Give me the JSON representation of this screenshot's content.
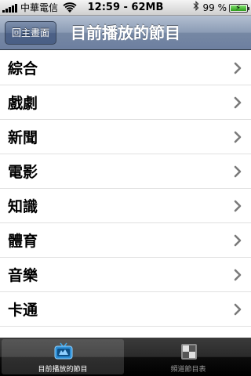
{
  "status_bar": {
    "carrier": "中華電信",
    "time": "12:59 - 62MB",
    "battery_percent": "99 %",
    "battery_level": 0.99
  },
  "nav": {
    "back_label": "回主畫面",
    "title": "目前播放的節目"
  },
  "list": {
    "items": [
      {
        "label": "綜合"
      },
      {
        "label": "戲劇"
      },
      {
        "label": "新聞"
      },
      {
        "label": "電影"
      },
      {
        "label": "知識"
      },
      {
        "label": "體育"
      },
      {
        "label": "音樂"
      },
      {
        "label": "卡通"
      },
      {
        "label": ""
      }
    ]
  },
  "tabbar": {
    "tabs": [
      {
        "label": "目前播放的節目",
        "icon": "tv-icon",
        "active": true
      },
      {
        "label": "頻道節目表",
        "icon": "grid-icon",
        "active": false
      }
    ]
  },
  "colors": {
    "nav_bar": "#7688a4",
    "tab_bar": "#000000",
    "tv_icon_blue": "#3fa7e8"
  }
}
